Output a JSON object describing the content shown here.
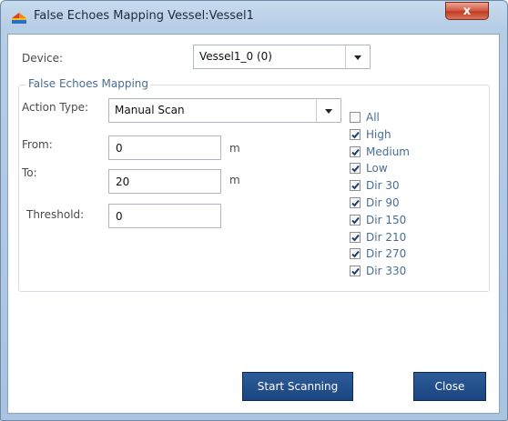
{
  "window": {
    "title": "False Echoes Mapping Vessel:Vessel1",
    "close_glyph": "x"
  },
  "device": {
    "label": "Device:",
    "value": "Vessel1_0 (0)"
  },
  "group": {
    "title": "False Echoes Mapping"
  },
  "action_type": {
    "label": "Action Type:",
    "value": "Manual Scan"
  },
  "from": {
    "label": "From:",
    "value": "0",
    "unit": "m"
  },
  "to": {
    "label": "To:",
    "value": "20",
    "unit": "m"
  },
  "threshold": {
    "label": "Threshold:",
    "value": "0"
  },
  "filters": [
    {
      "label": "All",
      "checked": false
    },
    {
      "label": "High",
      "checked": true
    },
    {
      "label": "Medium",
      "checked": true
    },
    {
      "label": "Low",
      "checked": true
    },
    {
      "label": "Dir 30",
      "checked": true
    },
    {
      "label": "Dir 90",
      "checked": true
    },
    {
      "label": "Dir 150",
      "checked": true
    },
    {
      "label": "Dir 210",
      "checked": true
    },
    {
      "label": "Dir 270",
      "checked": true
    },
    {
      "label": "Dir 330",
      "checked": true
    }
  ],
  "buttons": {
    "start": "Start Scanning",
    "close": "Close"
  },
  "colors": {
    "button_bg": "#1f4d8a",
    "group_title": "#4b6d94",
    "close_x": "#c94a30"
  }
}
